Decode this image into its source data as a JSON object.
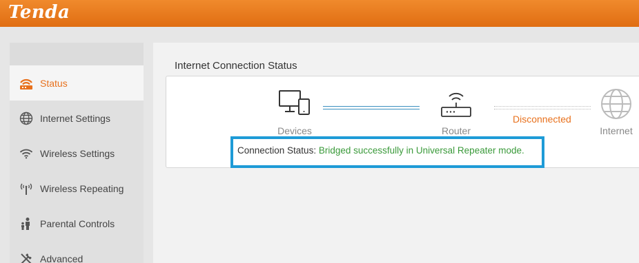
{
  "brand": {
    "logo_text": "Tenda",
    "accent": "#e8711d"
  },
  "sidebar": {
    "items": [
      {
        "label": "Status",
        "icon": "status-icon",
        "active": true
      },
      {
        "label": "Internet Settings",
        "icon": "globe-icon",
        "active": false
      },
      {
        "label": "Wireless Settings",
        "icon": "wifi-icon",
        "active": false
      },
      {
        "label": "Wireless Repeating",
        "icon": "repeater-icon",
        "active": false
      },
      {
        "label": "Parental Controls",
        "icon": "parental-icon",
        "active": false
      },
      {
        "label": "Advanced",
        "icon": "tools-icon",
        "active": false
      }
    ]
  },
  "main": {
    "section_title": "Internet Connection Status",
    "nodes": {
      "devices": {
        "label": "Devices",
        "icon": "devices-icon"
      },
      "router": {
        "label": "Router",
        "icon": "router-icon"
      },
      "internet": {
        "label": "Internet",
        "icon": "globe-icon"
      }
    },
    "link_status": "Disconnected",
    "connection": {
      "label": "Connection Status:",
      "value": "Bridged successfully in Universal Repeater mode."
    }
  }
}
